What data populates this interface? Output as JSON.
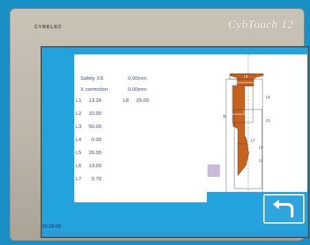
{
  "device": {
    "brand": "CYBELEC",
    "model": "CybTouch 12"
  },
  "screen": {
    "logo_text": "[-}-}",
    "safety": {
      "label": "Safety XS",
      "value": "0.00mm"
    },
    "correction": {
      "label": "X correction",
      "value": "0.00mm"
    },
    "params": [
      {
        "label": "L1",
        "value": "13.26"
      },
      {
        "label": "L2",
        "value": "10.00"
      },
      {
        "label": "L3",
        "value": "50.00"
      },
      {
        "label": "L4",
        "value": "0.00"
      },
      {
        "label": "L5",
        "value": "26.00"
      },
      {
        "label": "L6",
        "value": "13.00"
      },
      {
        "label": "L7",
        "value": "5.70"
      }
    ],
    "l8": {
      "label": "L8",
      "value": "25.00"
    },
    "diagram_labels": {
      "top": "L8",
      "l5": "L5",
      "l4": "L4",
      "l1": "L1",
      "l6": "L6",
      "l3": "L3",
      "l7": "L7",
      "l2": "L2",
      "side": "B"
    },
    "time": "15:29:09"
  },
  "colors": {
    "screen_bg": "#23a3de",
    "panel_bg": "#ffffff",
    "text": "#3e4f8a",
    "tool": "#c4621e",
    "button": "#2fa5e0"
  },
  "icons": {
    "back": "back-arrow-icon"
  }
}
